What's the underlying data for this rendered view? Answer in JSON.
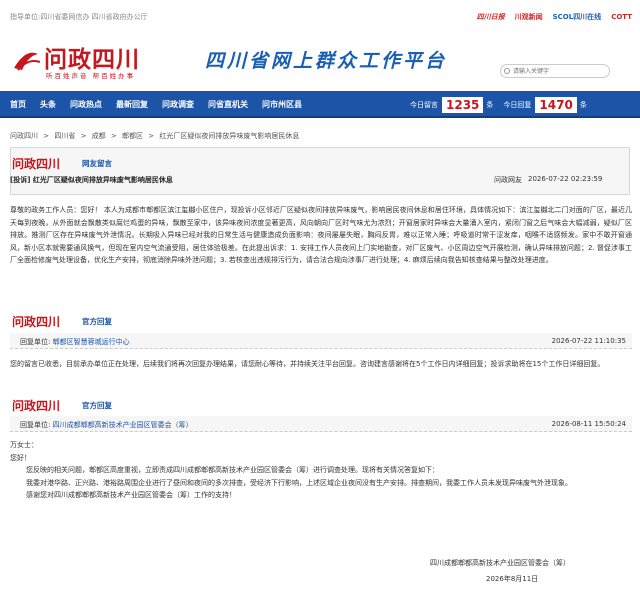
{
  "top": {
    "sponsor": "指导单位:四川省委网信办    四川省政府办公厅",
    "partners": [
      "四川日报",
      "川观新闻",
      "SCOL四川在线",
      "COTT"
    ]
  },
  "banner": {
    "logo_text": "问政四川",
    "logo_slogan": "听百姓声音 帮百姓办事",
    "platform_title": "四川省网上群众工作平台",
    "search_placeholder": "请输入关键字"
  },
  "nav": {
    "items": [
      "首页",
      "头条",
      "问政热点",
      "最新回复",
      "问政调查",
      "问省直机关",
      "问市州区县"
    ],
    "stats": {
      "label1": "今日留言",
      "value1": "1235",
      "unit1": "条",
      "label2": "今日回复",
      "value2": "1470",
      "unit2": "条"
    }
  },
  "breadcrumb": [
    "问政四川",
    ">",
    "四川省",
    ">",
    "成都",
    ">",
    "郫都区",
    ">",
    "红光厂区疑似夜间排放异味废气影响居民休息"
  ],
  "message": {
    "section_label": "网友留言",
    "title": "[投诉] 红光厂区疑似夜间排放异味废气影响居民休息",
    "author": "问政网友",
    "time": "2026-07-22 02:23:59",
    "body": "尊敬的政务工作人员：您好！ 本人为成都市郫都区滨江玺樾小区住户，现投诉小区邻近厂区疑似夜间排放异味废气，影响居民夜间休息和居住环境，具体情况如下：滨江玺樾北二门对面的厂区，最近几天每到夜晚，从外面就会飘散类似腐烂鸡蛋的异味，飘散至家中，该异味夜间浓度显著更高，风向朝向厂区时气味尤为浓烈；开窗居家时异味会大量涌入室内，紧闭门窗之后气味会大幅减弱，疑似厂区排放。推测厂区存在异味废气外泄情况。长期吸入异味已经对我的日常生活与健康造成负面影响：夜间屡屡失眠，胸闷反胃，难以正常入睡；呼吸道时常干涩发痒，咽喉不适感频发。家中不敢开窗通风，新小区本就需要通风换气，但现在室内空气流通受阻，居住体验极差。在此提出诉求：1. 安排工作人员夜间上门实地勘查，对厂区废气、小区周边空气开展检测，确认异味排放问题；2. 督促涉事工厂全面检修废气处理设备，优化生产安排，彻底消除异味外泄问题；3. 若核查出违规排污行为，请合法合规向涉事厂进行处理；4. 麻烦后续向我告知核查结果与整改处理进度。"
  },
  "reply1": {
    "section_label": "官方回复",
    "unit_key": "回复单位:",
    "unit": "郫都区智慧蓉城运行中心",
    "time": "2026-07-22 11:10:35",
    "body": "您的留言已收悉，目前承办单位正在处理，后续我们将再次回复办理结果，请您耐心等待，并持续关注平台回复。咨询建言感谢将在5个工作日内详细回复；投诉求助将在15个工作日详细回复。"
  },
  "reply2": {
    "section_label": "官方回复",
    "unit_key": "回复单位:",
    "unit": "四川成都郫都高新技术产业园区管委会（筹）",
    "time": "2026-08-11 15:50:24",
    "salutation": "万女士：",
    "greeting": "您好！",
    "para1": "您反映的相关问题，郫都区高度重视，立即责成四川成都郫都高新技术产业园区管委会（筹）进行调查处理。现将有关情况答复如下：",
    "para2": "我委对港华路、正兴路、港裕路周围企业进行了昼间和夜间的多次排查，受经济下行影响，上述区域企业夜间没有生产安排。排查期间，我委工作人员未发现异味废气外泄现象。",
    "para3": "感谢您对四川成都郫都高新技术产业园区管委会（筹）工作的支持！",
    "sign_org": "四川成都郫都高新技术产业园区管委会（筹）",
    "sign_date": "2026年8月11日"
  },
  "colors": {
    "brand_red": "#c8161d",
    "nav_blue": "#1c54a8"
  }
}
